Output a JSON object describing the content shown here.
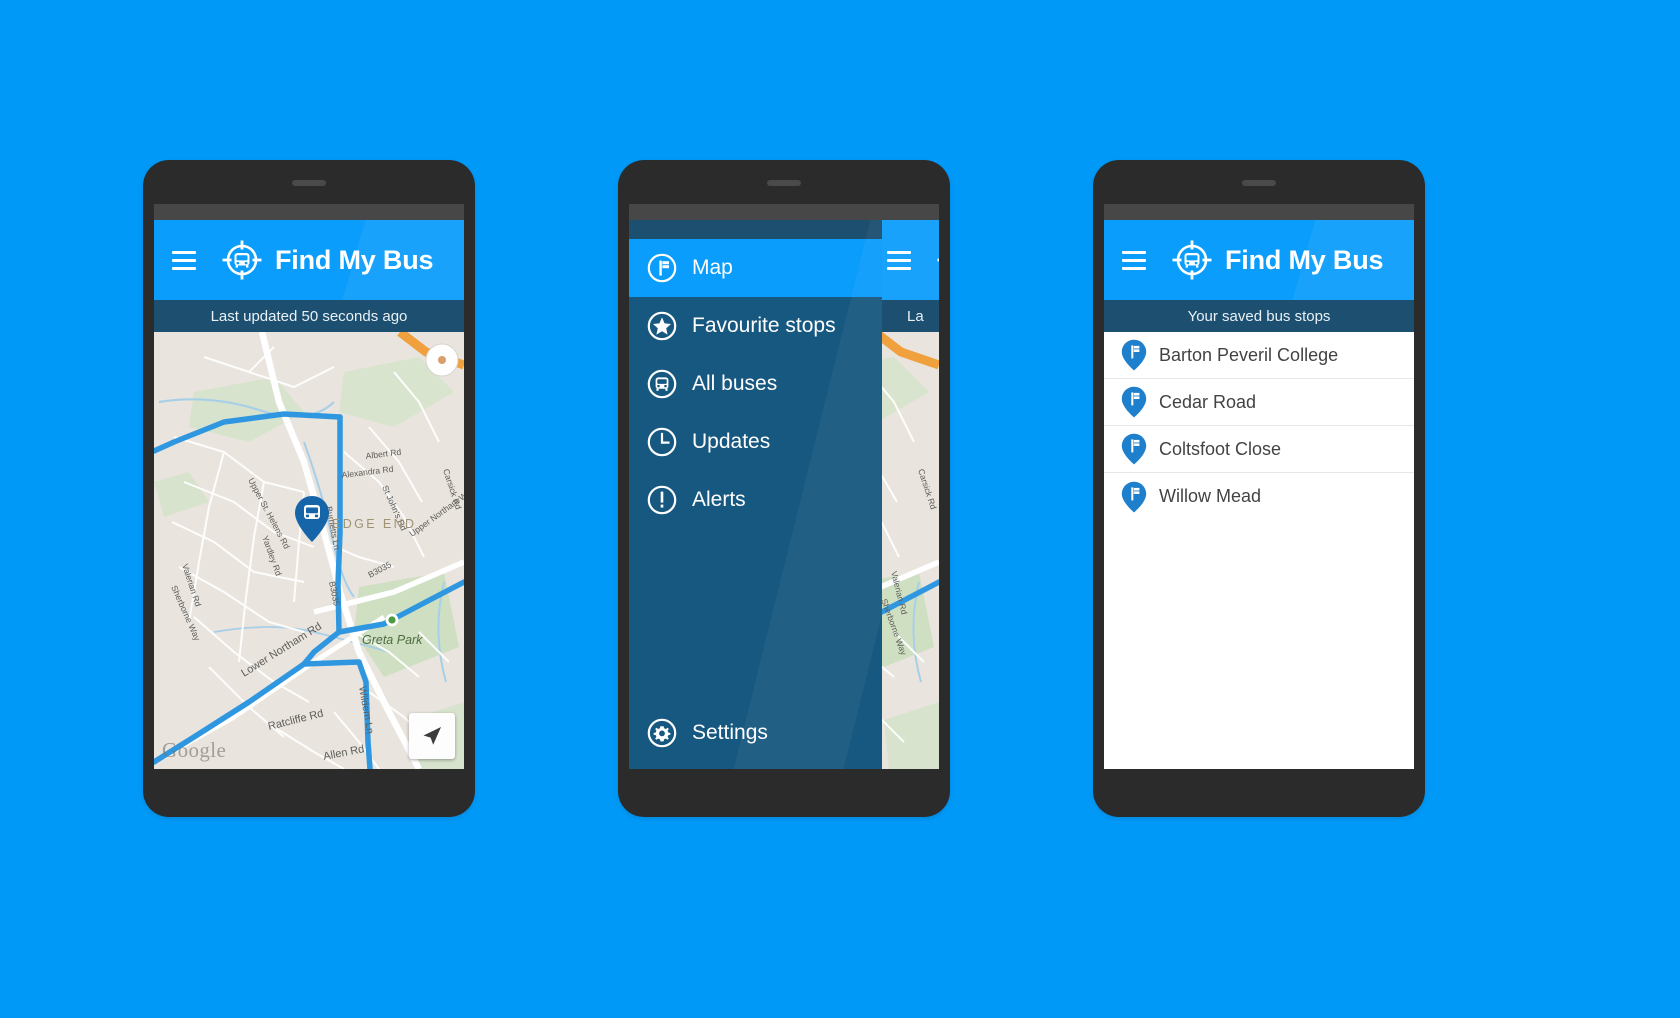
{
  "background_color": "#0099f7",
  "brand": {
    "name": "Find My Bus",
    "logo_icon": "bus-target-logo-icon",
    "menu_icon": "hamburger-menu-icon"
  },
  "theme": {
    "primary_blue": "#0b9dfb",
    "dark_blue": "#1d4f70",
    "drawer_blue": "#175880",
    "page_blue": "#0099f7",
    "frame_dark": "#2b2b2b"
  },
  "phone_map": {
    "screen_name": "map-screen",
    "status_text": "Last updated 50 seconds ago",
    "map": {
      "attribution": "Google",
      "place_labels": [
        "Albert Rd",
        "Alexandra Rd",
        "Upper St. Helens Rd",
        "St John's Rd",
        "Carsick Rd",
        "Yardley Rd",
        "Valerian Rd",
        "Sherborne Way",
        "Lower Northam Rd",
        "Ratcliffe Rd",
        "Allen Rd",
        "Wildern Ln",
        "Upper Northam Way",
        "B3035",
        "B3342",
        "Greta Park",
        "EDGE END"
      ],
      "bus_marker_icon": "bus-pin-icon",
      "locate_button_icon": "navigation-arrow-icon"
    }
  },
  "phone_drawer": {
    "screen_name": "navigation-drawer-screen",
    "behind_status_text": "La",
    "items": [
      {
        "label": "Map",
        "icon": "bus-stop-sign-icon",
        "active": true
      },
      {
        "label": "Favourite stops",
        "icon": "star-icon",
        "active": false
      },
      {
        "label": "All buses",
        "icon": "bus-icon",
        "active": false
      },
      {
        "label": "Updates",
        "icon": "clock-icon",
        "active": false
      },
      {
        "label": "Alerts",
        "icon": "exclamation-icon",
        "active": false
      }
    ],
    "bottom_item": {
      "label": "Settings",
      "icon": "gear-icon"
    }
  },
  "phone_saved": {
    "screen_name": "saved-stops-screen",
    "status_text": "Your saved bus stops",
    "stops": [
      {
        "name": "Barton Peveril College",
        "icon": "bus-stop-pin-icon"
      },
      {
        "name": "Cedar Road",
        "icon": "bus-stop-pin-icon"
      },
      {
        "name": "Coltsfoot Close",
        "icon": "bus-stop-pin-icon"
      },
      {
        "name": "Willow Mead",
        "icon": "bus-stop-pin-icon"
      }
    ]
  }
}
